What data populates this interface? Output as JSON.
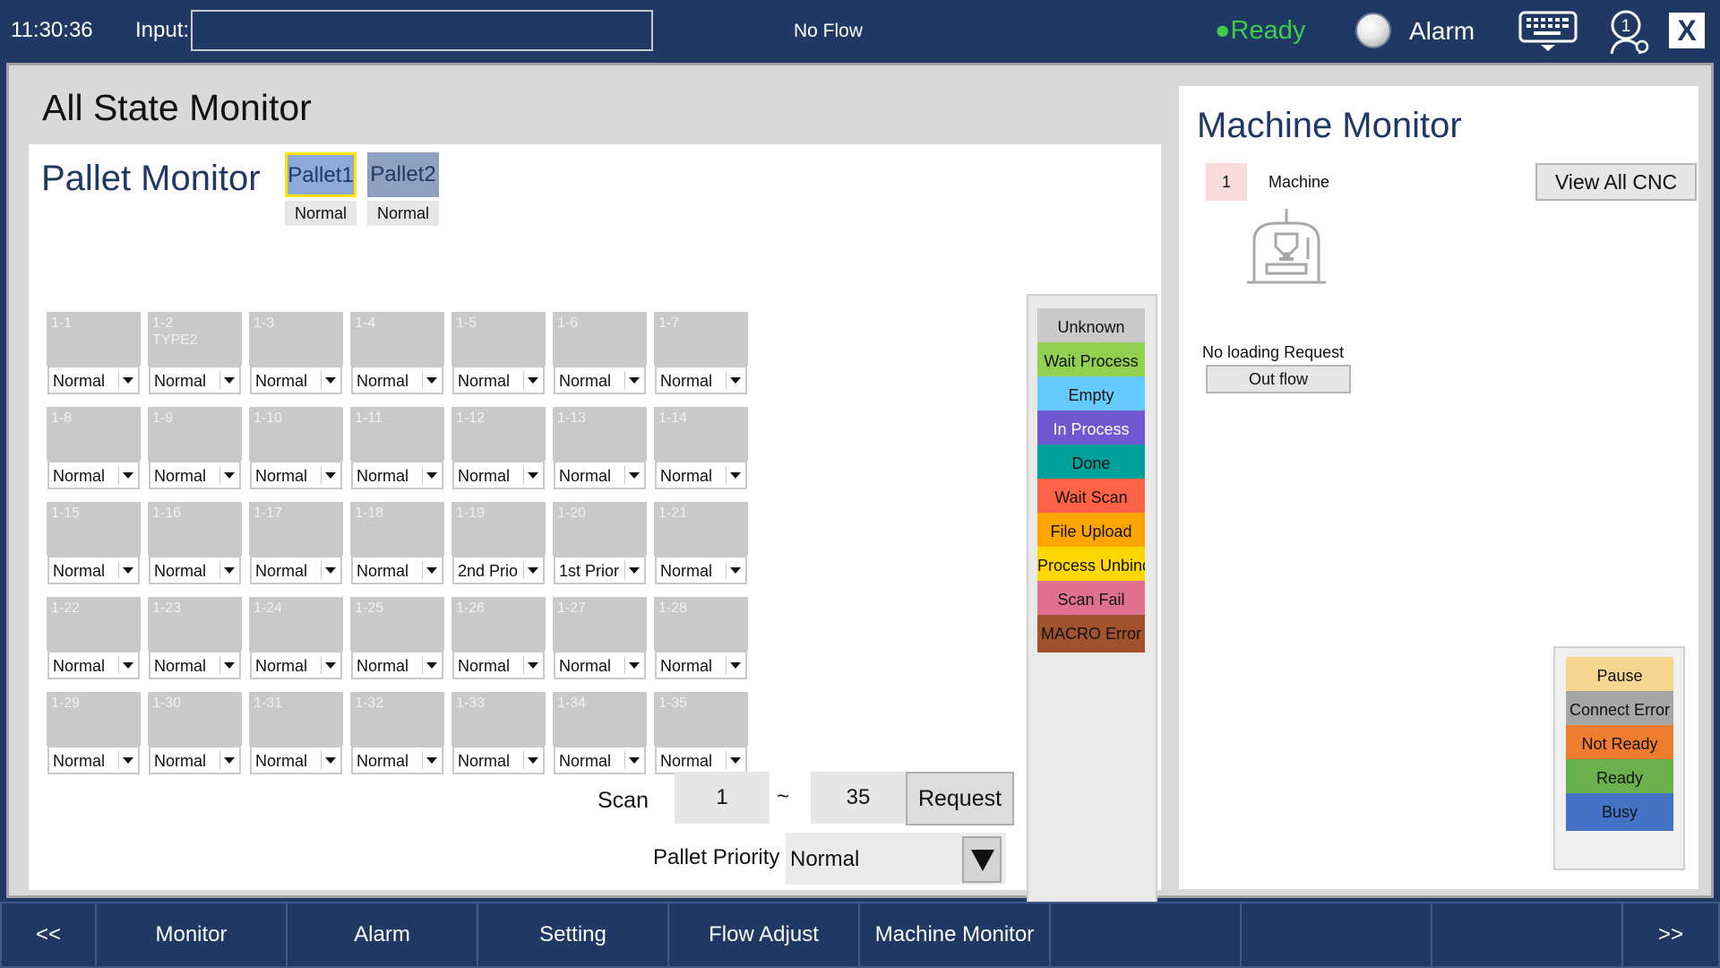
{
  "topbar": {
    "time": "11:30:36",
    "input_label": "Input:",
    "input_value": "",
    "flow_status": "No Flow",
    "ready_status": "●Ready",
    "alarm_label": "Alarm",
    "close_label": "X",
    "icons": [
      "alarm-light-icon",
      "keyboard-icon",
      "user-info-icon"
    ]
  },
  "page_title": "All State Monitor",
  "pallet_monitor": {
    "title": "Pallet Monitor",
    "tabs": [
      {
        "label": "Pallet1",
        "state": "Normal",
        "selected": true
      },
      {
        "label": "Pallet2",
        "state": "Normal",
        "selected": false
      }
    ],
    "stations": [
      {
        "id": "1-1",
        "type": "",
        "priority": "Normal"
      },
      {
        "id": "1-2",
        "type": "TYPE2",
        "priority": "Normal"
      },
      {
        "id": "1-3",
        "type": "",
        "priority": "Normal"
      },
      {
        "id": "1-4",
        "type": "",
        "priority": "Normal"
      },
      {
        "id": "1-5",
        "type": "",
        "priority": "Normal"
      },
      {
        "id": "1-6",
        "type": "",
        "priority": "Normal"
      },
      {
        "id": "1-7",
        "type": "",
        "priority": "Normal"
      },
      {
        "id": "1-8",
        "type": "",
        "priority": "Normal"
      },
      {
        "id": "1-9",
        "type": "",
        "priority": "Normal"
      },
      {
        "id": "1-10",
        "type": "",
        "priority": "Normal"
      },
      {
        "id": "1-11",
        "type": "",
        "priority": "Normal"
      },
      {
        "id": "1-12",
        "type": "",
        "priority": "Normal"
      },
      {
        "id": "1-13",
        "type": "",
        "priority": "Normal"
      },
      {
        "id": "1-14",
        "type": "",
        "priority": "Normal"
      },
      {
        "id": "1-15",
        "type": "",
        "priority": "Normal"
      },
      {
        "id": "1-16",
        "type": "",
        "priority": "Normal"
      },
      {
        "id": "1-17",
        "type": "",
        "priority": "Normal"
      },
      {
        "id": "1-18",
        "type": "",
        "priority": "Normal"
      },
      {
        "id": "1-19",
        "type": "",
        "priority": "2nd Prio"
      },
      {
        "id": "1-20",
        "type": "",
        "priority": "1st Prior"
      },
      {
        "id": "1-21",
        "type": "",
        "priority": "Normal"
      },
      {
        "id": "1-22",
        "type": "",
        "priority": "Normal"
      },
      {
        "id": "1-23",
        "type": "",
        "priority": "Normal"
      },
      {
        "id": "1-24",
        "type": "",
        "priority": "Normal"
      },
      {
        "id": "1-25",
        "type": "",
        "priority": "Normal"
      },
      {
        "id": "1-26",
        "type": "",
        "priority": "Normal"
      },
      {
        "id": "1-27",
        "type": "",
        "priority": "Normal"
      },
      {
        "id": "1-28",
        "type": "",
        "priority": "Normal"
      },
      {
        "id": "1-29",
        "type": "",
        "priority": "Normal"
      },
      {
        "id": "1-30",
        "type": "",
        "priority": "Normal"
      },
      {
        "id": "1-31",
        "type": "",
        "priority": "Normal"
      },
      {
        "id": "1-32",
        "type": "",
        "priority": "Normal"
      },
      {
        "id": "1-33",
        "type": "",
        "priority": "Normal"
      },
      {
        "id": "1-34",
        "type": "",
        "priority": "Normal"
      },
      {
        "id": "1-35",
        "type": "",
        "priority": "Normal"
      }
    ],
    "scan": {
      "label": "Scan",
      "from": "1",
      "separator": "~",
      "to": "35",
      "request_label": "Request"
    },
    "priority": {
      "label": "Pallet Priority",
      "value": "Normal"
    },
    "legend": [
      {
        "label": "Unknown",
        "color": "#c9c9c9",
        "text_color": "#111111"
      },
      {
        "label": "Wait Process",
        "color": "#92d050",
        "text_color": "#111111"
      },
      {
        "label": "Empty",
        "color": "#66ccff",
        "text_color": "#111111"
      },
      {
        "label": "In Process",
        "color": "#7058d0",
        "text_color": "#ffffff"
      },
      {
        "label": "Done",
        "color": "#00a09a",
        "text_color": "#111111"
      },
      {
        "label": "Wait Scan",
        "color": "#ff6247",
        "text_color": "#111111"
      },
      {
        "label": "File Upload",
        "color": "#ffa500",
        "text_color": "#111111"
      },
      {
        "label": "Process Unbind",
        "color": "#ffd700",
        "text_color": "#111111"
      },
      {
        "label": "Scan Fail",
        "color": "#e07090",
        "text_color": "#111111"
      },
      {
        "label": "MACRO Error",
        "color": "#a0522d",
        "text_color": "#111111"
      }
    ]
  },
  "machine_monitor": {
    "title": "Machine Monitor",
    "machine_number": "1",
    "machine_name": "Machine",
    "view_all_label": "View All CNC",
    "loading_request": "No loading Request",
    "outflow_label": "Out flow",
    "status_legend": [
      {
        "label": "Pause",
        "color": "#f5d68f"
      },
      {
        "label": "Connect Error",
        "color": "#a6a6a6"
      },
      {
        "label": "Not Ready",
        "color": "#f07c30"
      },
      {
        "label": "Ready",
        "color": "#6ab04c"
      },
      {
        "label": "Busy",
        "color": "#4472c4"
      }
    ]
  },
  "bottom_nav": [
    {
      "label": "<<"
    },
    {
      "label": "Monitor"
    },
    {
      "label": "Alarm"
    },
    {
      "label": "Setting"
    },
    {
      "label": "Flow Adjust"
    },
    {
      "label": "Machine Monitor"
    },
    {
      "label": ""
    },
    {
      "label": ""
    },
    {
      "label": ""
    },
    {
      "label": ">>"
    }
  ]
}
